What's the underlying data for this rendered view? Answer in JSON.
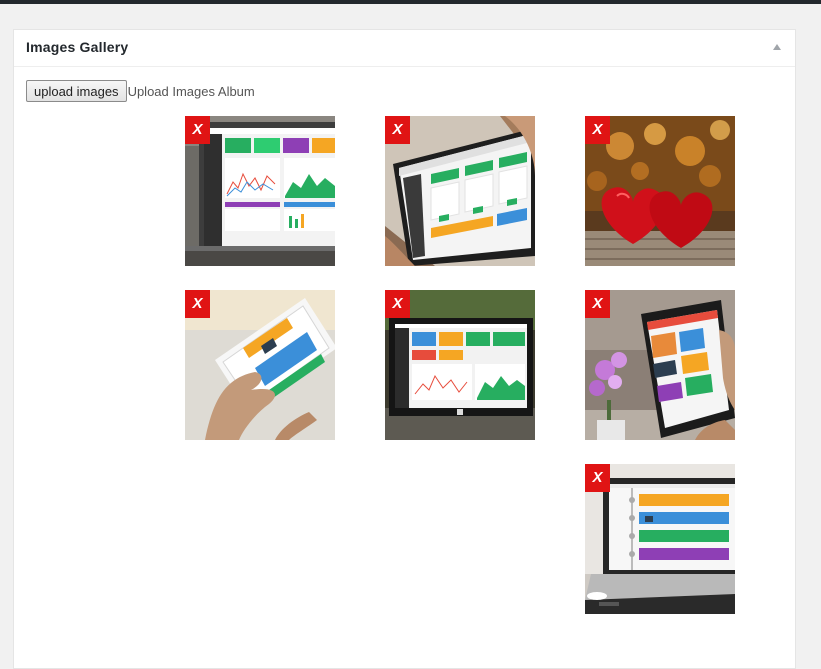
{
  "panel": {
    "title": "Images Gallery"
  },
  "upload": {
    "button_label": "upload images",
    "label": "Upload Images Album"
  },
  "gallery": {
    "remove_label": "X",
    "images": [
      {
        "subject": "laptop dashboard"
      },
      {
        "subject": "tablet dashboard"
      },
      {
        "subject": "red hearts"
      },
      {
        "subject": "phone app"
      },
      {
        "subject": "surface tablet dashboard"
      },
      {
        "subject": "ipad with flowers"
      },
      {
        "subject": "laptop timeline"
      }
    ]
  },
  "colors": {
    "remove_bg": "#e01414",
    "accent_green": "#27ae60",
    "accent_yellow": "#f5a623",
    "accent_blue": "#3b8fd9",
    "accent_purple": "#8e3fb5"
  }
}
